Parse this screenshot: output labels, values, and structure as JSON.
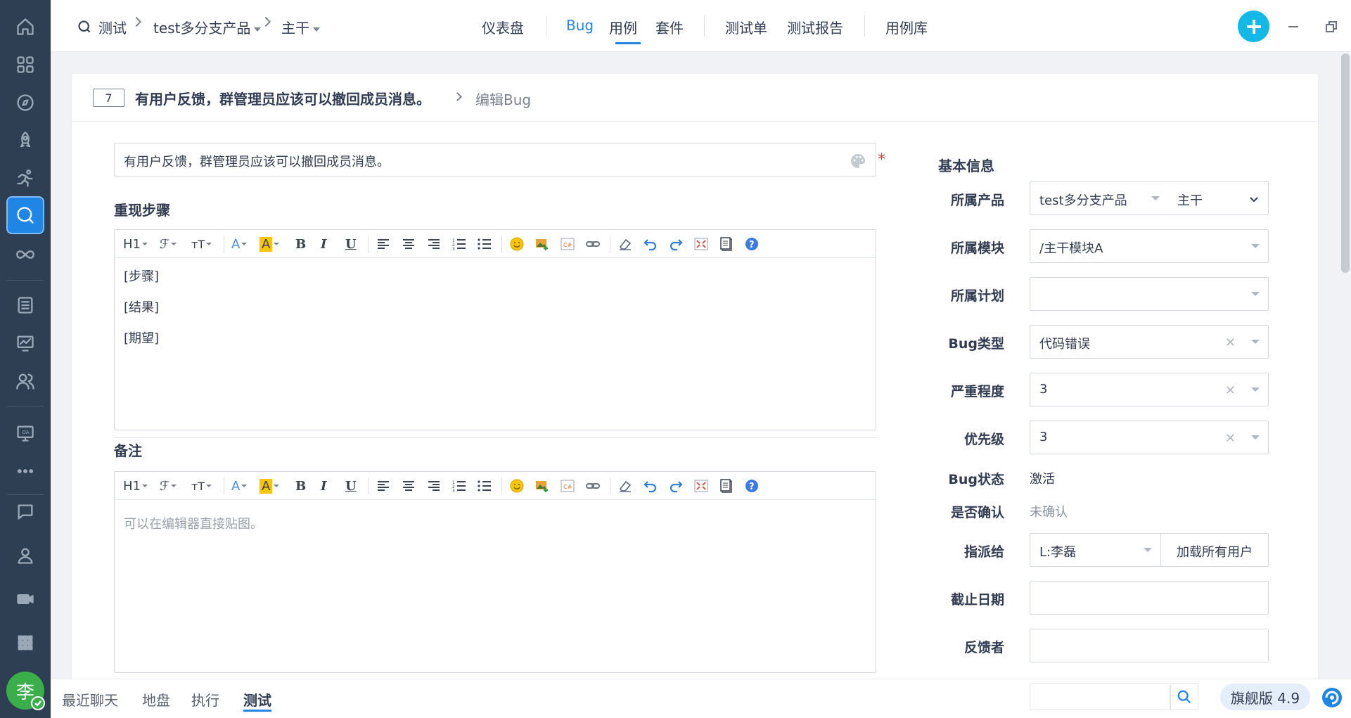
{
  "app": {
    "accent_color": "#1f86e6",
    "sidebar_color": "#2f3f53"
  },
  "sidebar": {
    "items": [
      {
        "name": "home-icon"
      },
      {
        "name": "grid-icon"
      },
      {
        "name": "compass-icon"
      },
      {
        "name": "rocket-icon"
      },
      {
        "name": "runner-icon"
      },
      {
        "name": "test-search-icon",
        "active": true
      },
      {
        "name": "infinity-icon"
      },
      {
        "name": "list-icon"
      },
      {
        "name": "monitor-chart-icon"
      },
      {
        "name": "users-icon"
      },
      {
        "name": "oa-icon"
      },
      {
        "name": "more-icon"
      },
      {
        "name": "chat-icon"
      },
      {
        "name": "user-icon"
      },
      {
        "name": "video-icon"
      },
      {
        "name": "apps-icon"
      }
    ],
    "avatar": "李"
  },
  "topbar": {
    "breadcrumb": {
      "module": "测试",
      "product": "test多分支产品",
      "branch": "主干"
    },
    "nav": {
      "dashboard": "仪表盘",
      "bug": "Bug",
      "case": "用例",
      "suite": "套件",
      "testtask": "测试单",
      "report": "测试报告",
      "caselib": "用例库"
    }
  },
  "header": {
    "bug_id": "7",
    "bug_title": "有用户反馈，群管理员应该可以撤回成员消息。",
    "action": "编辑Bug"
  },
  "form": {
    "title_value": "有用户反馈，群管理员应该可以撤回成员消息。",
    "steps_label": "重现步骤",
    "steps_lines": [
      "[步骤]",
      "[结果]",
      "[期望]"
    ],
    "notes_label": "备注",
    "notes_placeholder": "可以在编辑器直接贴图。",
    "toolbar": {
      "h1": "H1",
      "font": "ℱ",
      "size": "тT",
      "color": "A",
      "highlight": "A",
      "bold": "B",
      "italic": "I",
      "underline": "U"
    }
  },
  "side": {
    "title": "基本信息",
    "product_label": "所属产品",
    "product_value": "test多分支产品",
    "branch_value": "主干",
    "module_label": "所属模块",
    "module_value": "/主干模块A",
    "plan_label": "所属计划",
    "plan_value": "",
    "type_label": "Bug类型",
    "type_value": "代码错误",
    "severity_label": "严重程度",
    "severity_value": "3",
    "pri_label": "优先级",
    "pri_value": "3",
    "status_label": "Bug状态",
    "status_value": "激活",
    "confirm_label": "是否确认",
    "confirm_value": "未确认",
    "assign_label": "指派给",
    "assign_value": "L:李磊",
    "load_users": "加载所有用户",
    "deadline_label": "截止日期",
    "deadline_value": "",
    "feedback_label": "反馈者",
    "feedback_value": ""
  },
  "bottombar": {
    "tabs": [
      "最近聊天",
      "地盘",
      "执行",
      "测试"
    ],
    "active_tab": "测试",
    "version": "旗舰版 4.9"
  }
}
